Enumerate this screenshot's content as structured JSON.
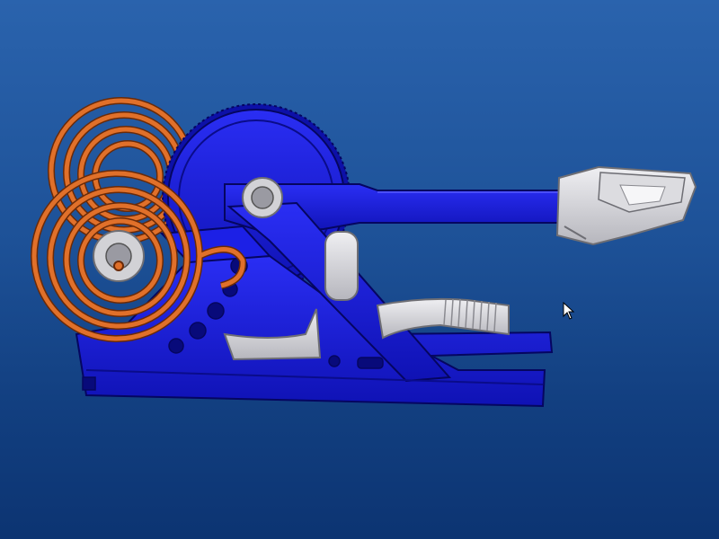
{
  "viewport": {
    "background_top": "#2a63ad",
    "background_bottom": "#0c3472"
  },
  "model": {
    "colors": {
      "frame": "#1a1ee0",
      "frame_dark": "#0d10a8",
      "frame_edge": "#050660",
      "spring": "#e0702a",
      "spring_edge": "#6a2a08",
      "grey_part": "#d2d2d6",
      "grey_edge": "#6e6e74"
    },
    "parts": [
      "spring-pair",
      "gear-wheel",
      "throwing-arm",
      "bucket",
      "base-frame",
      "trigger-lever",
      "bearings"
    ]
  },
  "cursor": {
    "icon": "arrow-cursor-icon"
  }
}
